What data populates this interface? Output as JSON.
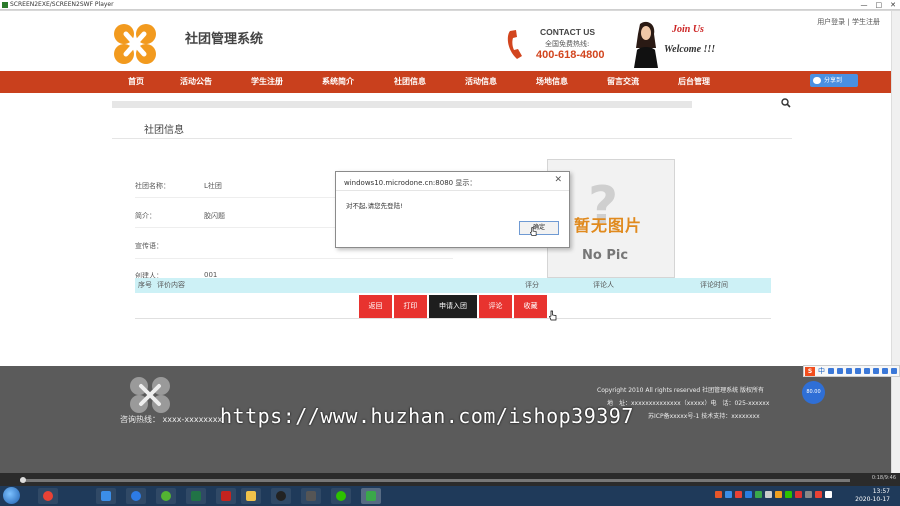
{
  "window": {
    "title": "SCREEN2EXE/SCREEN2SWF Player",
    "controls": [
      "—",
      "□",
      "✕"
    ]
  },
  "header": {
    "top_links": "用户登录 | 学生注册",
    "site_title": "社团管理系统",
    "contact_title": "CONTACT US",
    "contact_sub": "全国免费热线:",
    "contact_phone": "400-618-4800",
    "join": "Join Us",
    "welcome": "Welcome !!!"
  },
  "nav": {
    "items": [
      "首页",
      "活动公告",
      "学生注册",
      "系统简介",
      "社团信息",
      "活动信息",
      "场地信息",
      "留言交流",
      "后台管理"
    ],
    "share_label": "分享到"
  },
  "section": {
    "title": "社团信息",
    "fields": [
      {
        "label": "社团名称：",
        "value": "L社团"
      },
      {
        "label": "简介：",
        "value": "胶闪题"
      },
      {
        "label": "宣传语：",
        "value": ""
      },
      {
        "label": "创建人：",
        "value": "001"
      }
    ],
    "no_pic_cn": "暂无图片",
    "no_pic_en": "No Pic"
  },
  "table": {
    "headers": [
      "序号",
      "评价内容",
      "评分",
      "评论人",
      "评论时间"
    ]
  },
  "buttons": [
    "返回",
    "打印",
    "申请入团",
    "评论",
    "收藏"
  ],
  "dialog": {
    "title": "windows10.microdone.cn:8080 显示：",
    "close": "✕",
    "message": "对不起,请您先登陆!",
    "ok": "确定"
  },
  "footer": {
    "hotline": "咨询热线：  xxxx-xxxxxxxx",
    "copyright": "Copyright 2010 All rights reserved 社团管理系统 版权所有",
    "address": "地　址：xxxxxxxxxxxxxx（xxxxx）电　话：025-xxxxxx",
    "icp": "苏ICP备xxxxx号-1 技术支持：xxxxxxxx",
    "watermark": "https://www.huzhan.com/ishop39397"
  },
  "ime": {
    "logo": "S",
    "mode": "中",
    "badge": "80.00"
  },
  "player": {
    "time": "0:18/9:46"
  },
  "taskbar": {
    "time": "13:57",
    "date": "2020-10-17"
  },
  "colors": {
    "nav": "#c9401d",
    "button": "#e8332f",
    "button_dark": "#1e1e1e",
    "table_header": "#cdf1f6",
    "footer": "#5b5b5b"
  }
}
